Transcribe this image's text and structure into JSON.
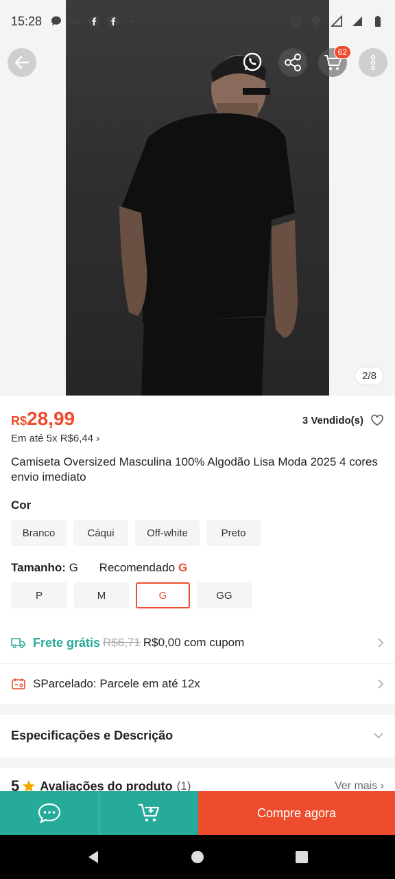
{
  "status_bar": {
    "time": "15:28",
    "left_icons": [
      "chat-bubble-icon",
      "olx-icon",
      "facebook-icon",
      "facebook-icon",
      "dot-icon"
    ],
    "right_icons": [
      "alarm-icon",
      "wifi-icon",
      "signal-icon",
      "signal-icon",
      "battery-icon"
    ],
    "olx_text": "olx"
  },
  "header": {
    "cart_badge": "62"
  },
  "gallery": {
    "counter": "2/8",
    "current": 2,
    "total": 8
  },
  "product": {
    "currency": "R$",
    "price": "28,99",
    "sold": "3 Vendido(s)",
    "installments": "Em até 5x R$6,44 ›",
    "title": "Camiseta Oversized Masculina 100%  Algodão Lisa Moda 2025 4 cores envio imediato"
  },
  "color": {
    "label": "Cor",
    "options": [
      "Branco",
      "Cáqui",
      "Off-white",
      "Preto"
    ]
  },
  "size": {
    "label": "Tamanho:",
    "value": "G",
    "recommended_label": "Recomendado",
    "recommended_value": "G",
    "options": [
      "P",
      "M",
      "G",
      "GG"
    ],
    "selected": "G"
  },
  "shipping": {
    "label": "Frete grátis",
    "old_price": "R$6,71",
    "new_price": "R$0,00 com cupom"
  },
  "installment_row": {
    "label": "SParcelado: Parcele em até 12x"
  },
  "specs": {
    "label": "Especificações e Descrição"
  },
  "reviews": {
    "rating": "5",
    "label": "Avaliações do produto",
    "count": "(1)",
    "see_more": "Ver mais ›"
  },
  "actions": {
    "buy_now": "Compre agora"
  },
  "colors": {
    "accent": "#ee4d2d",
    "teal": "#26aa99"
  }
}
